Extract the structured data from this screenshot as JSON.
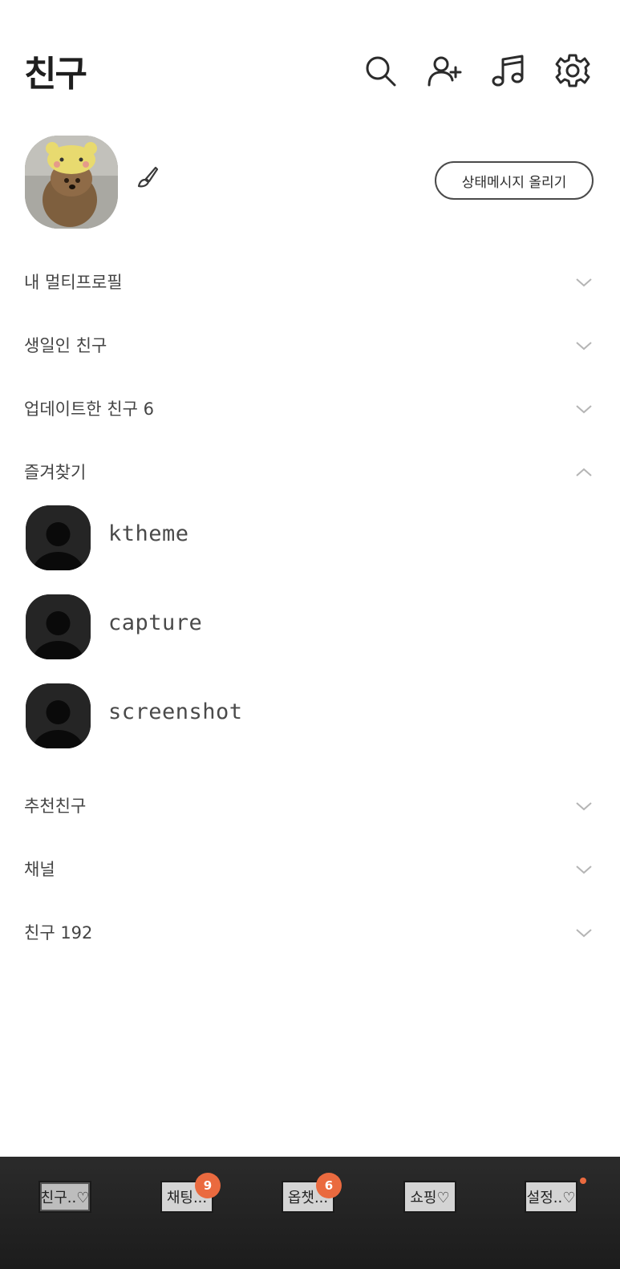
{
  "header": {
    "title": "친구",
    "icons": [
      "search-icon",
      "add-friend-icon",
      "music-icon",
      "settings-icon"
    ]
  },
  "profile": {
    "status_button": "상태메시지 올리기"
  },
  "sections_top": [
    {
      "label": "내 멀티프로필",
      "state": "collapsed"
    },
    {
      "label": "생일인 친구",
      "state": "collapsed"
    },
    {
      "label": "업데이트한 친구 6",
      "state": "collapsed"
    },
    {
      "label": "즐겨찾기",
      "state": "expanded"
    }
  ],
  "favorites": [
    {
      "name": "ktheme"
    },
    {
      "name": "capture"
    },
    {
      "name": "screenshot"
    }
  ],
  "sections_bottom": [
    {
      "label": "추천친구",
      "state": "collapsed"
    },
    {
      "label": "채널",
      "state": "collapsed"
    },
    {
      "label": "친구 192",
      "state": "collapsed"
    }
  ],
  "tabs": [
    {
      "label": "친구..♡",
      "active": true,
      "badge": ""
    },
    {
      "label": "채팅...",
      "active": false,
      "badge": "9"
    },
    {
      "label": "옵챗...",
      "active": false,
      "badge": "6"
    },
    {
      "label": "쇼핑♡",
      "active": false,
      "badge": ""
    },
    {
      "label": "설정..♡",
      "active": false,
      "badge": "",
      "dot": true
    }
  ],
  "colors": {
    "badge": "#ea6a3f",
    "tabbar": "#232323",
    "text": "#2b2b2b"
  }
}
